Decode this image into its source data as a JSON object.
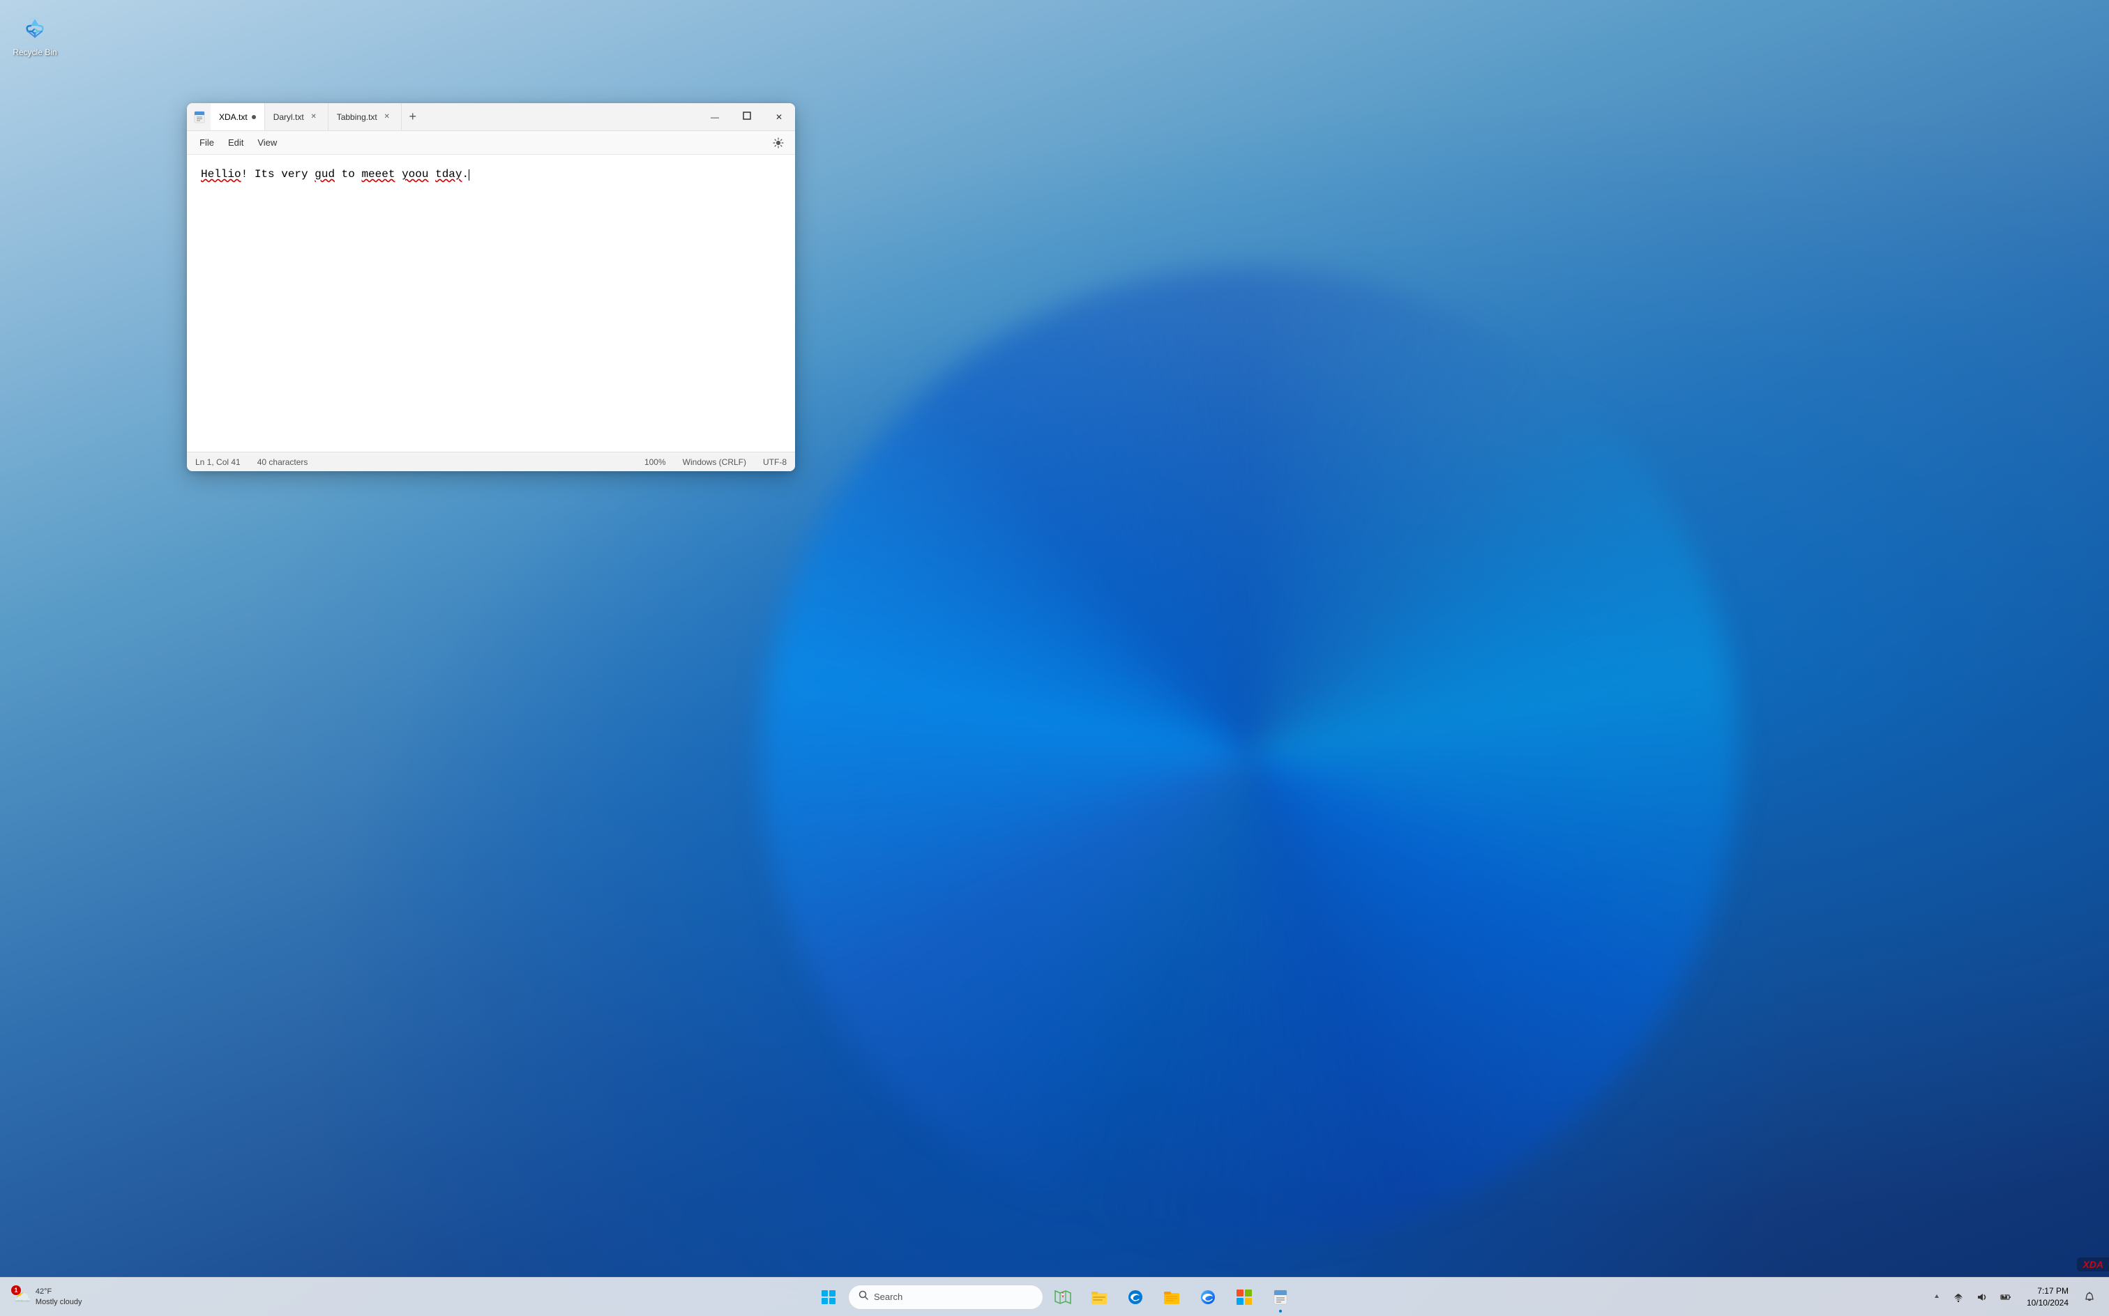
{
  "desktop": {
    "background_description": "Windows 11 bloom wallpaper with blue swirls"
  },
  "recycle_bin": {
    "label": "Recycle Bin",
    "icon": "🗑️"
  },
  "notepad": {
    "window_title": "Notepad",
    "tabs": [
      {
        "id": "tab1",
        "label": "XDA.txt",
        "active": true,
        "modified": true
      },
      {
        "id": "tab2",
        "label": "Daryl.txt",
        "active": false,
        "modified": false
      },
      {
        "id": "tab3",
        "label": "Tabbing.txt",
        "active": false,
        "modified": false
      }
    ],
    "add_tab_label": "+",
    "menu": {
      "file_label": "File",
      "edit_label": "Edit",
      "view_label": "View"
    },
    "editor": {
      "content_plain": "Hellio! Its very gud to meeet yoou tday.",
      "content_segments": [
        {
          "text": "Hellio",
          "misspelled": true
        },
        {
          "text": "! Its very ",
          "misspelled": false
        },
        {
          "text": "gud",
          "misspelled": true
        },
        {
          "text": " to ",
          "misspelled": false
        },
        {
          "text": "meeet",
          "misspelled": true
        },
        {
          "text": " ",
          "misspelled": false
        },
        {
          "text": "yoou",
          "misspelled": true
        },
        {
          "text": " ",
          "misspelled": false
        },
        {
          "text": "tday",
          "misspelled": true
        },
        {
          "text": ".",
          "misspelled": false
        }
      ]
    },
    "status_bar": {
      "cursor_position": "Ln 1, Col 41",
      "char_count": "40 characters",
      "zoom": "100%",
      "line_ending": "Windows (CRLF)",
      "encoding": "UTF-8"
    },
    "window_controls": {
      "minimize_symbol": "—",
      "maximize_symbol": "⬜",
      "close_symbol": "✕"
    }
  },
  "taskbar": {
    "start_button_label": "Start",
    "search_placeholder": "Search",
    "apps": [
      {
        "id": "start",
        "icon": "⊞",
        "label": "Start",
        "active": false
      },
      {
        "id": "search",
        "icon": "🔍",
        "label": "Search",
        "active": false
      },
      {
        "id": "maps",
        "icon": "🗺",
        "label": "Maps",
        "active": false
      },
      {
        "id": "file-manager-alt",
        "icon": "🗂",
        "label": "File Explorer Alt",
        "active": false
      },
      {
        "id": "edge-blue",
        "icon": "🌐",
        "label": "Edge Alt",
        "active": false
      },
      {
        "id": "file-manager",
        "icon": "📁",
        "label": "File Explorer",
        "active": false
      },
      {
        "id": "edge",
        "icon": "🔵",
        "label": "Edge",
        "active": false
      },
      {
        "id": "windows-store",
        "icon": "🛍",
        "label": "Microsoft Store",
        "active": false
      },
      {
        "id": "notepad",
        "icon": "📝",
        "label": "Notepad",
        "active": true
      }
    ],
    "system_tray": {
      "time": "7:17 PM",
      "date": "10/10/2024",
      "show_hidden_label": "^",
      "network_icon": "📶",
      "volume_icon": "🔊",
      "battery_icon": "🔋",
      "notification_icon": "🔔"
    },
    "weather": {
      "temperature": "42°F",
      "condition": "Mostly cloudy",
      "icon": "☁️",
      "badge": "1"
    }
  }
}
